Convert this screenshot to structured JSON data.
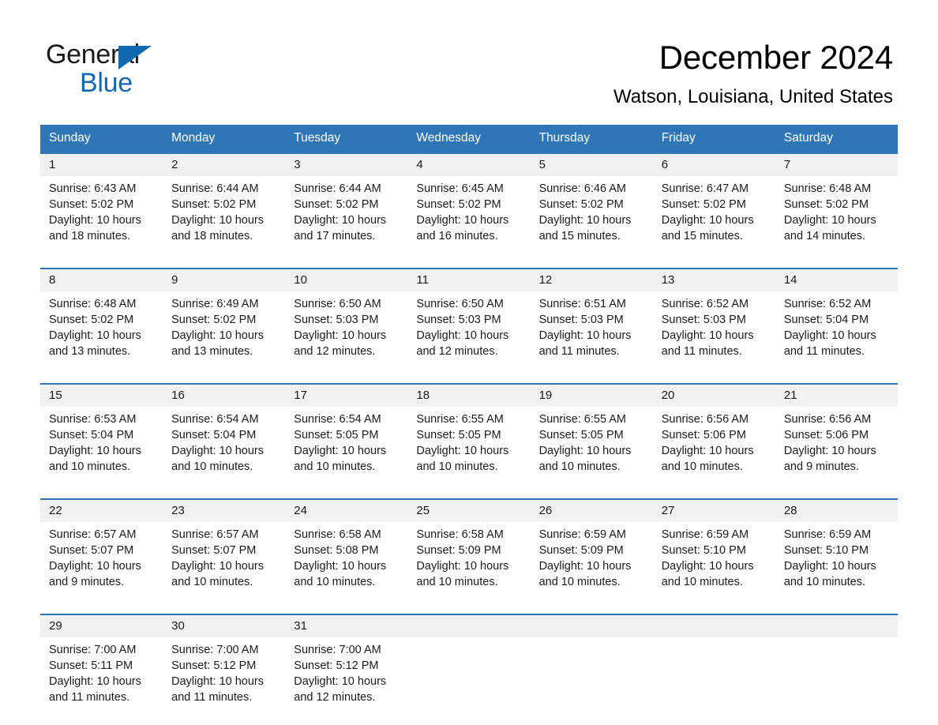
{
  "brand": {
    "logo_line1": "General",
    "logo_line2": "Blue",
    "accent_color": "#1268b3",
    "header_color": "#2f76b7"
  },
  "header": {
    "title": "December 2024",
    "subtitle": "Watson, Louisiana, United States"
  },
  "calendar": {
    "weekday_headers": [
      "Sunday",
      "Monday",
      "Tuesday",
      "Wednesday",
      "Thursday",
      "Friday",
      "Saturday"
    ],
    "weeks": [
      [
        {
          "day": "1",
          "sunrise": "Sunrise: 6:43 AM",
          "sunset": "Sunset: 5:02 PM",
          "daylight": "Daylight: 10 hours and 18 minutes."
        },
        {
          "day": "2",
          "sunrise": "Sunrise: 6:44 AM",
          "sunset": "Sunset: 5:02 PM",
          "daylight": "Daylight: 10 hours and 18 minutes."
        },
        {
          "day": "3",
          "sunrise": "Sunrise: 6:44 AM",
          "sunset": "Sunset: 5:02 PM",
          "daylight": "Daylight: 10 hours and 17 minutes."
        },
        {
          "day": "4",
          "sunrise": "Sunrise: 6:45 AM",
          "sunset": "Sunset: 5:02 PM",
          "daylight": "Daylight: 10 hours and 16 minutes."
        },
        {
          "day": "5",
          "sunrise": "Sunrise: 6:46 AM",
          "sunset": "Sunset: 5:02 PM",
          "daylight": "Daylight: 10 hours and 15 minutes."
        },
        {
          "day": "6",
          "sunrise": "Sunrise: 6:47 AM",
          "sunset": "Sunset: 5:02 PM",
          "daylight": "Daylight: 10 hours and 15 minutes."
        },
        {
          "day": "7",
          "sunrise": "Sunrise: 6:48 AM",
          "sunset": "Sunset: 5:02 PM",
          "daylight": "Daylight: 10 hours and 14 minutes."
        }
      ],
      [
        {
          "day": "8",
          "sunrise": "Sunrise: 6:48 AM",
          "sunset": "Sunset: 5:02 PM",
          "daylight": "Daylight: 10 hours and 13 minutes."
        },
        {
          "day": "9",
          "sunrise": "Sunrise: 6:49 AM",
          "sunset": "Sunset: 5:02 PM",
          "daylight": "Daylight: 10 hours and 13 minutes."
        },
        {
          "day": "10",
          "sunrise": "Sunrise: 6:50 AM",
          "sunset": "Sunset: 5:03 PM",
          "daylight": "Daylight: 10 hours and 12 minutes."
        },
        {
          "day": "11",
          "sunrise": "Sunrise: 6:50 AM",
          "sunset": "Sunset: 5:03 PM",
          "daylight": "Daylight: 10 hours and 12 minutes."
        },
        {
          "day": "12",
          "sunrise": "Sunrise: 6:51 AM",
          "sunset": "Sunset: 5:03 PM",
          "daylight": "Daylight: 10 hours and 11 minutes."
        },
        {
          "day": "13",
          "sunrise": "Sunrise: 6:52 AM",
          "sunset": "Sunset: 5:03 PM",
          "daylight": "Daylight: 10 hours and 11 minutes."
        },
        {
          "day": "14",
          "sunrise": "Sunrise: 6:52 AM",
          "sunset": "Sunset: 5:04 PM",
          "daylight": "Daylight: 10 hours and 11 minutes."
        }
      ],
      [
        {
          "day": "15",
          "sunrise": "Sunrise: 6:53 AM",
          "sunset": "Sunset: 5:04 PM",
          "daylight": "Daylight: 10 hours and 10 minutes."
        },
        {
          "day": "16",
          "sunrise": "Sunrise: 6:54 AM",
          "sunset": "Sunset: 5:04 PM",
          "daylight": "Daylight: 10 hours and 10 minutes."
        },
        {
          "day": "17",
          "sunrise": "Sunrise: 6:54 AM",
          "sunset": "Sunset: 5:05 PM",
          "daylight": "Daylight: 10 hours and 10 minutes."
        },
        {
          "day": "18",
          "sunrise": "Sunrise: 6:55 AM",
          "sunset": "Sunset: 5:05 PM",
          "daylight": "Daylight: 10 hours and 10 minutes."
        },
        {
          "day": "19",
          "sunrise": "Sunrise: 6:55 AM",
          "sunset": "Sunset: 5:05 PM",
          "daylight": "Daylight: 10 hours and 10 minutes."
        },
        {
          "day": "20",
          "sunrise": "Sunrise: 6:56 AM",
          "sunset": "Sunset: 5:06 PM",
          "daylight": "Daylight: 10 hours and 10 minutes."
        },
        {
          "day": "21",
          "sunrise": "Sunrise: 6:56 AM",
          "sunset": "Sunset: 5:06 PM",
          "daylight": "Daylight: 10 hours and 9 minutes."
        }
      ],
      [
        {
          "day": "22",
          "sunrise": "Sunrise: 6:57 AM",
          "sunset": "Sunset: 5:07 PM",
          "daylight": "Daylight: 10 hours and 9 minutes."
        },
        {
          "day": "23",
          "sunrise": "Sunrise: 6:57 AM",
          "sunset": "Sunset: 5:07 PM",
          "daylight": "Daylight: 10 hours and 10 minutes."
        },
        {
          "day": "24",
          "sunrise": "Sunrise: 6:58 AM",
          "sunset": "Sunset: 5:08 PM",
          "daylight": "Daylight: 10 hours and 10 minutes."
        },
        {
          "day": "25",
          "sunrise": "Sunrise: 6:58 AM",
          "sunset": "Sunset: 5:09 PM",
          "daylight": "Daylight: 10 hours and 10 minutes."
        },
        {
          "day": "26",
          "sunrise": "Sunrise: 6:59 AM",
          "sunset": "Sunset: 5:09 PM",
          "daylight": "Daylight: 10 hours and 10 minutes."
        },
        {
          "day": "27",
          "sunrise": "Sunrise: 6:59 AM",
          "sunset": "Sunset: 5:10 PM",
          "daylight": "Daylight: 10 hours and 10 minutes."
        },
        {
          "day": "28",
          "sunrise": "Sunrise: 6:59 AM",
          "sunset": "Sunset: 5:10 PM",
          "daylight": "Daylight: 10 hours and 10 minutes."
        }
      ],
      [
        {
          "day": "29",
          "sunrise": "Sunrise: 7:00 AM",
          "sunset": "Sunset: 5:11 PM",
          "daylight": "Daylight: 10 hours and 11 minutes."
        },
        {
          "day": "30",
          "sunrise": "Sunrise: 7:00 AM",
          "sunset": "Sunset: 5:12 PM",
          "daylight": "Daylight: 10 hours and 11 minutes."
        },
        {
          "day": "31",
          "sunrise": "Sunrise: 7:00 AM",
          "sunset": "Sunset: 5:12 PM",
          "daylight": "Daylight: 10 hours and 12 minutes."
        },
        {
          "day": "",
          "sunrise": "",
          "sunset": "",
          "daylight": ""
        },
        {
          "day": "",
          "sunrise": "",
          "sunset": "",
          "daylight": ""
        },
        {
          "day": "",
          "sunrise": "",
          "sunset": "",
          "daylight": ""
        },
        {
          "day": "",
          "sunrise": "",
          "sunset": "",
          "daylight": ""
        }
      ]
    ]
  }
}
